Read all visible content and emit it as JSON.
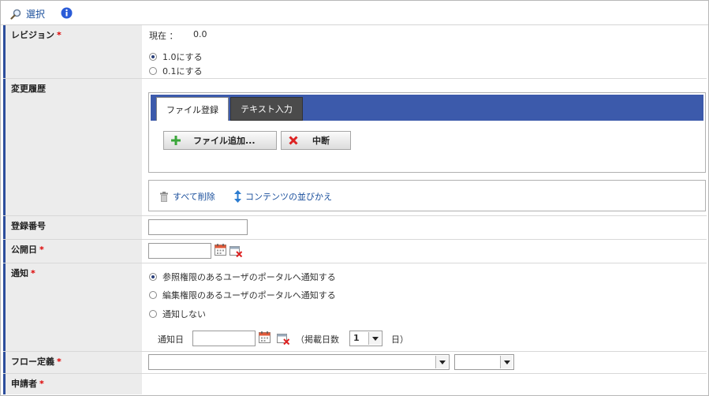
{
  "toolbar": {
    "select_label": "選択"
  },
  "revision": {
    "label": "レビジョン",
    "required": "*",
    "current_label": "現在 ：",
    "current_value": "0.0",
    "options": [
      "1.0にする",
      "0.1にする"
    ],
    "selected": 0
  },
  "history": {
    "label": "変更履歴",
    "tabs": [
      "ファイル登録",
      "テキスト入力"
    ],
    "add_file_button": "ファイル追加...",
    "abort_button": "中断",
    "delete_all_link": "すべて削除",
    "sort_link": "コンテンツの並びかえ"
  },
  "reg_number": {
    "label": "登録番号",
    "value": ""
  },
  "publish_date": {
    "label": "公開日",
    "required": "*",
    "value": ""
  },
  "notify": {
    "label": "通知",
    "required": "*",
    "options": [
      "参照権限のあるユーザのポータルへ通知する",
      "編集権限のあるユーザのポータルへ通知する",
      "通知しない"
    ],
    "selected": 0,
    "date_label": "通知日",
    "days_prefix": "（掲載日数",
    "days_value": "1",
    "days_suffix": "日）"
  },
  "flow": {
    "label": "フロー定義",
    "required": "*"
  },
  "applicant": {
    "label": "申請者",
    "required": "*"
  },
  "colors": {
    "accent": "#3c5aab",
    "label_bg": "#ececec",
    "required": "#dd0000",
    "link": "#1a4f9c"
  }
}
